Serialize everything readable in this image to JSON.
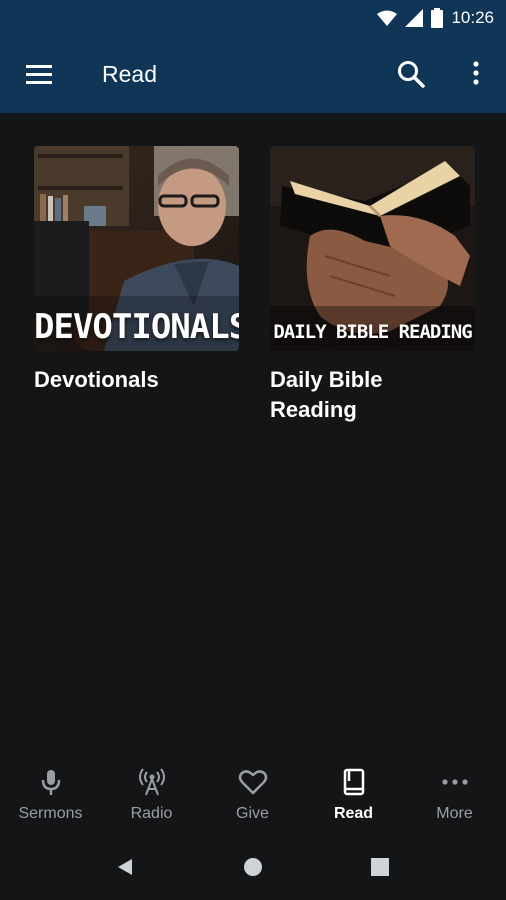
{
  "status_bar": {
    "time": "10:26"
  },
  "app_bar": {
    "title": "Read"
  },
  "cards": [
    {
      "overlay": "DEVOTIONALS",
      "label": "Devotionals"
    },
    {
      "overlay": "DAILY BIBLE READING",
      "label": "Daily Bible Reading"
    }
  ],
  "bottom_nav": [
    {
      "label": "Sermons",
      "icon": "microphone-icon"
    },
    {
      "label": "Radio",
      "icon": "radio-tower-icon"
    },
    {
      "label": "Give",
      "icon": "heart-icon"
    },
    {
      "label": "Read",
      "icon": "book-icon",
      "active": true
    },
    {
      "label": "More",
      "icon": "more-horizontal-icon"
    }
  ],
  "colors": {
    "app_bar": "#0f3557",
    "background": "#141517",
    "inactive": "#9a9ea3",
    "active": "#ffffff"
  }
}
